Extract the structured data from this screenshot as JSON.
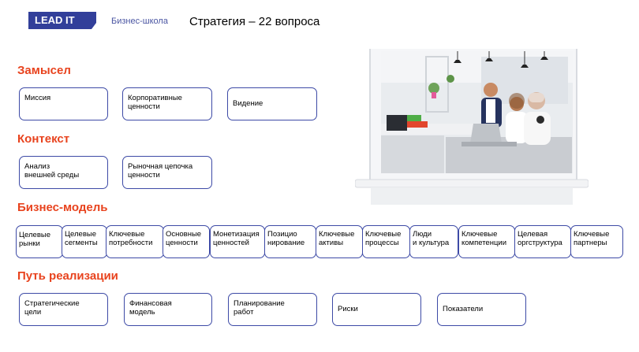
{
  "header": {
    "logo_text": "LEAD IT",
    "subtitle": "Бизнес-школа",
    "title": "Стратегия – 22 вопроса"
  },
  "sections": {
    "s1": "Замысел",
    "s2": "Контекст",
    "s3": "Бизнес-модель",
    "s4": "Путь реализации"
  },
  "boxes": {
    "mission": "Миссия",
    "corp_values": "Корпоративные\nценности",
    "vision": "Видение",
    "env_analysis": "Анализ\nвнешней среды",
    "value_chain": "Рыночная цепочка\nценности",
    "target_markets": "Целевые\nрынки",
    "target_segments": "Целевые\nсегменты",
    "key_needs": "Ключевые\nпотребности",
    "core_values": "Основные\nценности",
    "monetization": "Монетизация\nценностей",
    "positioning": "Позицио\nнирование",
    "key_assets": "Ключевые\nактивы",
    "key_processes": "Ключевые\nпроцессы",
    "people_culture": "Люди\nи культура",
    "key_competencies": "Ключевые\nкомпетенции",
    "target_org": "Целевая\nоргструктура",
    "key_partners": "Ключевые\nпартнеры",
    "strategic_goals": "Стратегические\nцели",
    "financial_model": "Финансовая\nмодель",
    "work_planning": "Планирование\nработ",
    "risks": "Риски",
    "indicators": "Показатели"
  },
  "colors": {
    "accent": "#e8431e",
    "border": "#3d4aa6",
    "logo_bg": "#323f9a"
  },
  "image": {
    "icon": "office-photo-laptop"
  }
}
